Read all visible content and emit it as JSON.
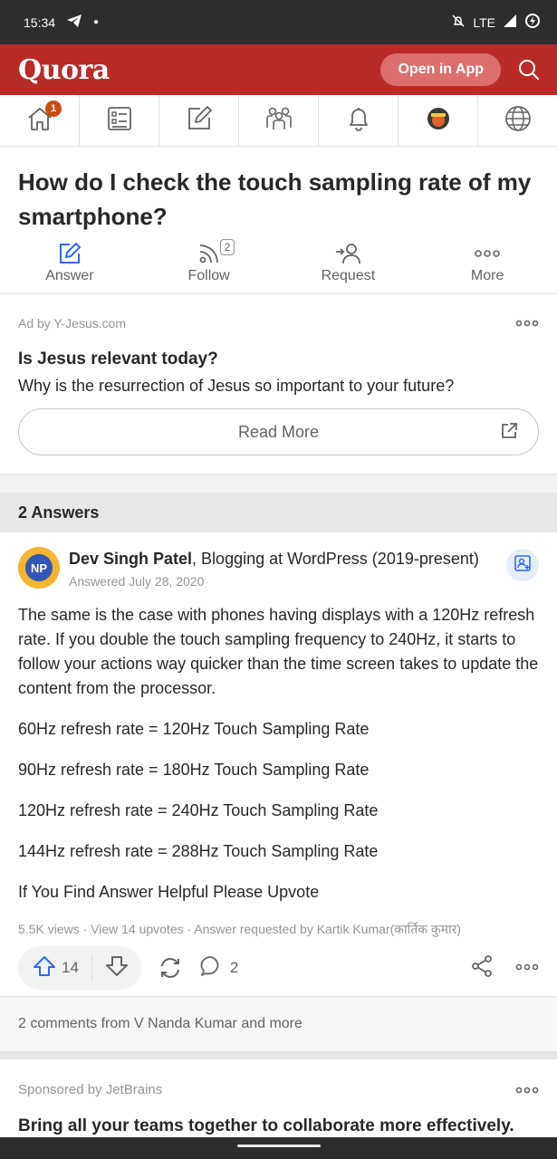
{
  "status_bar": {
    "time": "15:34",
    "network": "LTE"
  },
  "header": {
    "logo": "Quora",
    "open_in_app": "Open in App"
  },
  "nav": {
    "notification_count": "1"
  },
  "question": {
    "title": "How do I check the touch sampling rate of my smartphone?",
    "actions": [
      {
        "label": "Answer"
      },
      {
        "label": "Follow",
        "count": "2"
      },
      {
        "label": "Request"
      },
      {
        "label": "More"
      }
    ]
  },
  "ad": {
    "by": "Ad by Y-Jesus.com",
    "headline": "Is Jesus relevant today?",
    "subtext": "Why is the resurrection of Jesus so important to your future?",
    "button": "Read More"
  },
  "answers_header": "2 Answers",
  "answer": {
    "avatar_initials": "NP",
    "author_name": "Dev Singh Patel",
    "author_credential": ", Blogging at WordPress (2019-present)",
    "date": "Answered July 28, 2020",
    "paragraphs": [
      "The same is the case with phones having displays with a 120Hz refresh rate. If you double the touch sampling frequency to 240Hz, it starts to follow your actions way quicker than the time screen takes to update the content from the processor.",
      "60Hz refresh rate = 120Hz Touch Sampling Rate",
      "90Hz refresh rate = 180Hz Touch Sampling Rate",
      "120Hz refresh rate = 240Hz Touch Sampling Rate",
      "144Hz refresh rate = 288Hz Touch Sampling Rate",
      "If You Find Answer Helpful Please Upvote"
    ],
    "meta": "5.5K views · View 14 upvotes · Answer requested by Kartik Kumar(कार्तिक कुमार)",
    "upvotes": "14",
    "comment_count": "2",
    "comments_preview": "2 comments from V Nanda Kumar and more"
  },
  "sponsored": {
    "by": "Sponsored by JetBrains",
    "headline": "Bring all your teams together to collaborate more effectively."
  },
  "colors": {
    "brand": "#b92b27",
    "accent": "#2e69ff"
  }
}
